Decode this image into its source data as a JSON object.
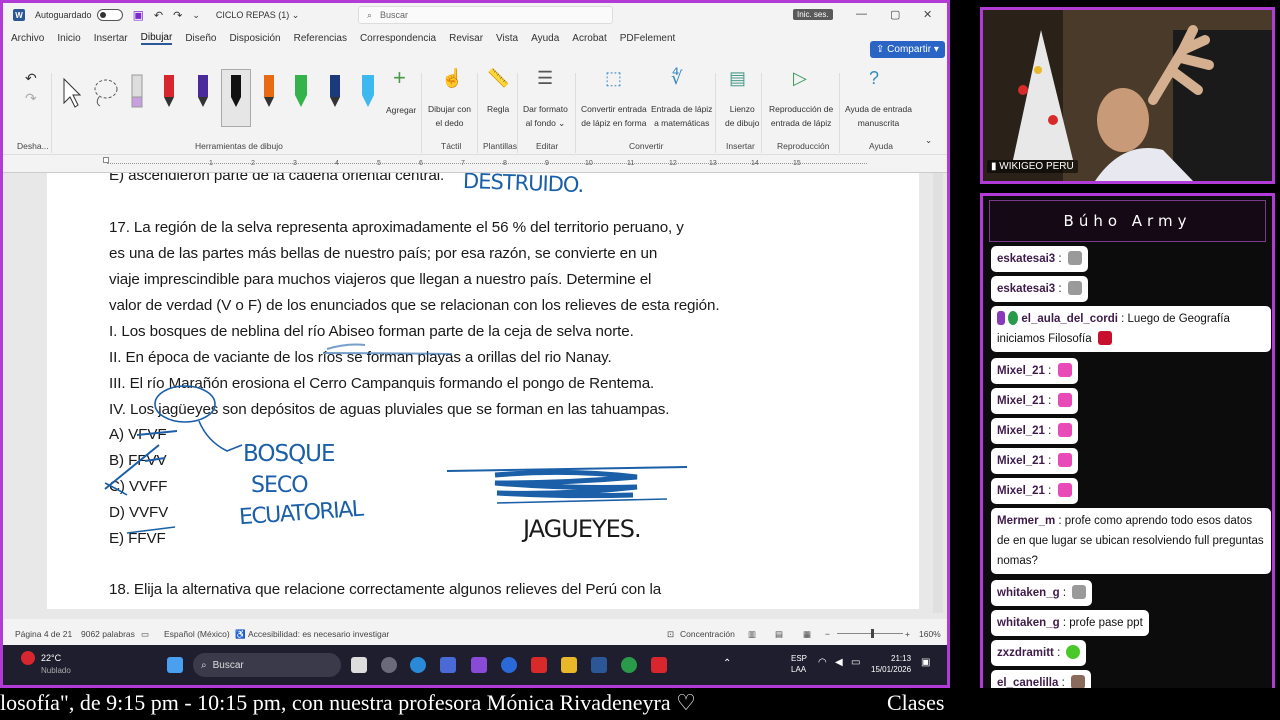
{
  "word": {
    "autosave_label": "Autoguardado",
    "doc_title": "CICLO REPAS (1)",
    "title_arrow": "⌄",
    "search_placeholder": "Buscar",
    "signin_label": "Inic. ses.",
    "menu": [
      "Archivo",
      "Inicio",
      "Insertar",
      "Dibujar",
      "Diseño",
      "Disposición",
      "Referencias",
      "Correspondencia",
      "Revisar",
      "Vista",
      "Ayuda",
      "Acrobat",
      "PDFelement"
    ],
    "share_label": "Compartir",
    "ribbon": {
      "undo_group": "Desha...",
      "tools_group": "Herramientas de dibujo",
      "add_label": "Agregar",
      "draw_finger": [
        "Dibujar con",
        "el dedo"
      ],
      "touch_group": "Táctil",
      "ruler_label": "Regla",
      "templates_group": "Plantillas",
      "bg_format": [
        "Dar formato",
        "al fondo"
      ],
      "edit_group": "Editar",
      "convert_shape": [
        "Convertir entrada",
        "de lápiz en forma"
      ],
      "math_input": [
        "Entrada de lápiz",
        "a matemáticas"
      ],
      "convert_group": "Convertir",
      "canvas": [
        "Lienzo",
        "de dibujo"
      ],
      "insert_group": "Insertar",
      "replay": [
        "Reproducción de",
        "entrada de lápiz"
      ],
      "replay_group": "Reproducción",
      "help_ink": [
        "Ayuda de entrada",
        "manuscrita"
      ],
      "help_group": "Ayuda"
    },
    "ruler_numbers": [
      "1",
      "2",
      "3",
      "4",
      "5",
      "6",
      "7",
      "8",
      "9",
      "10",
      "11",
      "12",
      "13",
      "14",
      "15"
    ],
    "document": {
      "prev_line": "E) ascendieron parte de la cadena oriental central.",
      "q17": [
        "17. La región de la selva representa aproximadamente el 56 % del territorio peruano, y",
        "es una de las partes más bellas de nuestro país; por esa razón, se convierte en un",
        "viaje imprescindible para muchos viajeros que llegan a nuestro país. Determine el",
        "valor de verdad (V o F) de los enunciados que se relacionan con los relieves de esta región.",
        "I. Los bosques de neblina del río Abiseo forman parte de la ceja de selva norte.",
        "II. En época de vaciante de los ríos se forman playas a orillas del rio Nanay.",
        "III. El río Marañón erosiona el Cerro Campanquis formando el pongo de Rentema.",
        "IV. Los jagüeyes son depósitos de aguas pluviales que se forman en las tahuampas."
      ],
      "options": [
        "A) VFVF",
        "B) FFVV",
        "C) VVFF",
        "D) VVFV",
        "E) FFVF"
      ],
      "handwriting": {
        "top": "DESTRUIDO.",
        "bosque": [
          "BOSQUE",
          "SECO",
          "ECUATORIAL"
        ],
        "jagueyes": "JAGUEYES."
      },
      "q18": "18. Elija la alternativa que relacione correctamente algunos relieves del Perú con la"
    },
    "status": {
      "page": "Página 4 de 21",
      "words": "9062 palabras",
      "lang": "Español (México)",
      "access": "Accesibilidad: es necesario investigar",
      "focus": "Concentración",
      "zoom": "160%"
    },
    "taskbar": {
      "temp": "22°C",
      "weather": "Nublado",
      "search": "Buscar",
      "lang": [
        "ESP",
        "LAA"
      ],
      "time": "21:13",
      "date": "15/01/2026"
    }
  },
  "cam": {
    "label": "WIKIGEO PERU"
  },
  "chat": {
    "title": "Búho Army",
    "messages": [
      {
        "user": "eskatesai3",
        "text": ""
      },
      {
        "user": "eskatesai3",
        "text": ""
      },
      {
        "user": "el_aula_del_cordi",
        "text": "Luego de Geografía iniciamos Filosofía"
      },
      {
        "user": "Mixel_21",
        "text": ""
      },
      {
        "user": "Mixel_21",
        "text": ""
      },
      {
        "user": "Mixel_21",
        "text": ""
      },
      {
        "user": "Mixel_21",
        "text": ""
      },
      {
        "user": "Mixel_21",
        "text": ""
      },
      {
        "user": "Mermer_m",
        "text": "profe como aprendo todo esos datos de en que lugar se ubican resolviendo full preguntas nomas?"
      },
      {
        "user": "whitaken_g",
        "text": ""
      },
      {
        "user": "whitaken_g",
        "text": "profe pase ppt"
      },
      {
        "user": "zxzdramitt",
        "text": ""
      },
      {
        "user": "el_canelilla",
        "text": ""
      }
    ],
    "colors": {
      "accent": "#b23bd8",
      "bubble": "#ffffff"
    }
  },
  "ticker": {
    "text": "losofía\", de 9:15 pm - 10:15 pm, con nuestra profesora Mónica Rivadeneyra  ♡",
    "right": "Clases"
  }
}
